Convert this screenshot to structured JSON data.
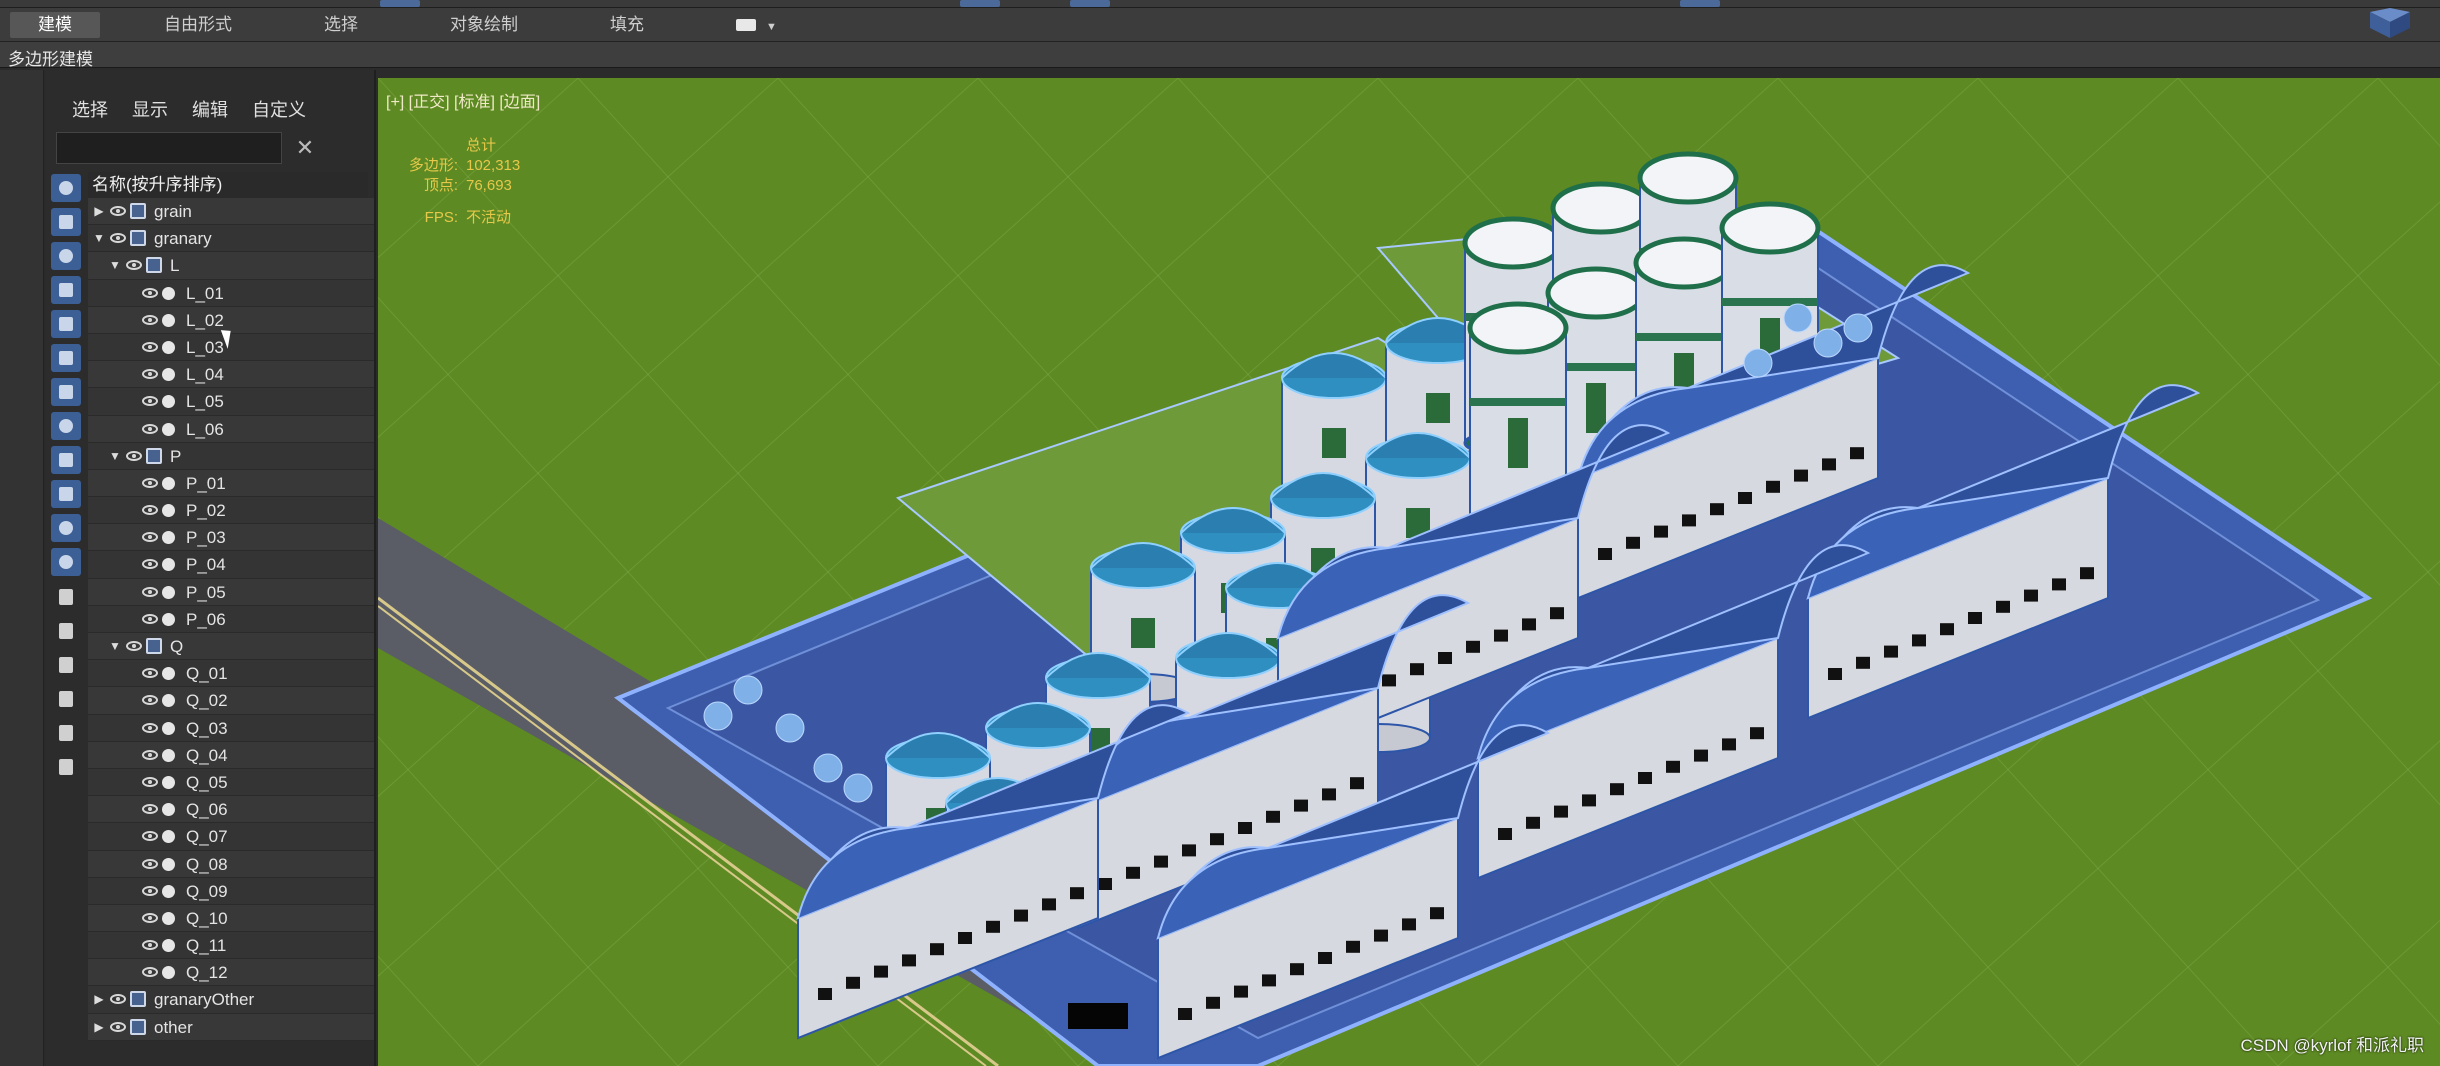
{
  "ribbon": {
    "tabs": [
      "建模",
      "自由形式",
      "选择",
      "对象绘制",
      "填充"
    ],
    "active_tab": "建模",
    "subtitle": "多边形建模"
  },
  "explorer": {
    "menu": [
      "选择",
      "显示",
      "编辑",
      "自定义"
    ],
    "search_placeholder": "",
    "column_header": "名称(按升序排序)",
    "tree": [
      {
        "level": 0,
        "type": "group",
        "label": "grain",
        "expanded": false
      },
      {
        "level": 0,
        "type": "group",
        "label": "granary",
        "expanded": true
      },
      {
        "level": 1,
        "type": "group",
        "label": "L",
        "expanded": true
      },
      {
        "level": 2,
        "type": "object",
        "label": "L_01"
      },
      {
        "level": 2,
        "type": "object",
        "label": "L_02"
      },
      {
        "level": 2,
        "type": "object",
        "label": "L_03"
      },
      {
        "level": 2,
        "type": "object",
        "label": "L_04"
      },
      {
        "level": 2,
        "type": "object",
        "label": "L_05"
      },
      {
        "level": 2,
        "type": "object",
        "label": "L_06"
      },
      {
        "level": 1,
        "type": "group",
        "label": "P",
        "expanded": true
      },
      {
        "level": 2,
        "type": "object",
        "label": "P_01"
      },
      {
        "level": 2,
        "type": "object",
        "label": "P_02"
      },
      {
        "level": 2,
        "type": "object",
        "label": "P_03"
      },
      {
        "level": 2,
        "type": "object",
        "label": "P_04"
      },
      {
        "level": 2,
        "type": "object",
        "label": "P_05"
      },
      {
        "level": 2,
        "type": "object",
        "label": "P_06"
      },
      {
        "level": 1,
        "type": "group",
        "label": "Q",
        "expanded": true
      },
      {
        "level": 2,
        "type": "object",
        "label": "Q_01"
      },
      {
        "level": 2,
        "type": "object",
        "label": "Q_02"
      },
      {
        "level": 2,
        "type": "object",
        "label": "Q_03"
      },
      {
        "level": 2,
        "type": "object",
        "label": "Q_04"
      },
      {
        "level": 2,
        "type": "object",
        "label": "Q_05"
      },
      {
        "level": 2,
        "type": "object",
        "label": "Q_06"
      },
      {
        "level": 2,
        "type": "object",
        "label": "Q_07"
      },
      {
        "level": 2,
        "type": "object",
        "label": "Q_08"
      },
      {
        "level": 2,
        "type": "object",
        "label": "Q_09"
      },
      {
        "level": 2,
        "type": "object",
        "label": "Q_10"
      },
      {
        "level": 2,
        "type": "object",
        "label": "Q_11"
      },
      {
        "level": 2,
        "type": "object",
        "label": "Q_12"
      },
      {
        "level": 0,
        "type": "group",
        "label": "granaryOther",
        "expanded": false
      },
      {
        "level": 0,
        "type": "group",
        "label": "other",
        "expanded": false
      }
    ]
  },
  "viewport": {
    "label": "[+] [正交] [标准] [边面]",
    "stats_title": "总计",
    "poly_label": "多边形:",
    "poly_value": "102,313",
    "vert_label": "顶点:",
    "vert_value": "76,693",
    "fps_label": "FPS:",
    "fps_value": "不活动"
  },
  "watermark": "CSDN @kyrlof 和派礼职",
  "colors": {
    "grass": "#5d8a22",
    "platform": "#3e5fb0",
    "roof": "#2e4f9a",
    "accent": "#4b6a9a"
  }
}
